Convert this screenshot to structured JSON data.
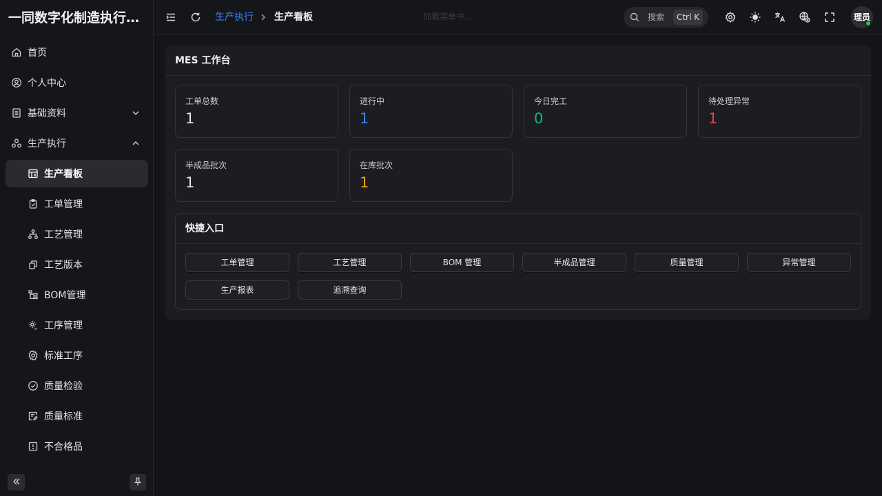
{
  "app": {
    "title": "一同数字化制造执行管..."
  },
  "colors": {
    "accent": "#3b82f6",
    "success": "#10b981",
    "danger": "#ef4444",
    "warning": "#f59e0b",
    "online": "#22c55e"
  },
  "sidebar": {
    "items": [
      {
        "label": "首页",
        "icon": "home-icon"
      },
      {
        "label": "个人中心",
        "icon": "user-circle-icon"
      },
      {
        "label": "基础资料",
        "icon": "document-list-icon",
        "expanded": false
      },
      {
        "label": "生产执行",
        "icon": "flow-nodes-icon",
        "expanded": true
      }
    ],
    "subitems": [
      {
        "label": "生产看板",
        "icon": "calendar-board-icon",
        "active": true
      },
      {
        "label": "工单管理",
        "icon": "clipboard-check-icon"
      },
      {
        "label": "工艺管理",
        "icon": "hierarchy-icon"
      },
      {
        "label": "工艺版本",
        "icon": "copy-icon"
      },
      {
        "label": "BOM管理",
        "icon": "tree-list-icon"
      },
      {
        "label": "工序管理",
        "icon": "gear-settings-icon"
      },
      {
        "label": "标准工序",
        "icon": "cog-icon"
      },
      {
        "label": "质量检验",
        "icon": "check-circle-icon"
      },
      {
        "label": "质量标准",
        "icon": "document-edit-icon"
      },
      {
        "label": "不合格品",
        "icon": "alert-square-icon"
      }
    ]
  },
  "header": {
    "breadcrumb": [
      "生产执行",
      "生产看板"
    ],
    "loading_text": "加载菜单中...",
    "search": {
      "placeholder": "搜索",
      "shortcut": "Ctrl K"
    },
    "avatar_text": "理员"
  },
  "main": {
    "card_title": "MES 工作台",
    "stats": [
      {
        "label": "工单总数",
        "value": "1",
        "color": "#e6e6e6"
      },
      {
        "label": "进行中",
        "value": "1",
        "color": "#3b82f6"
      },
      {
        "label": "今日完工",
        "value": "0",
        "color": "#10b981"
      },
      {
        "label": "待处理异常",
        "value": "1",
        "color": "#ef4444"
      },
      {
        "label": "半成品批次",
        "value": "1",
        "color": "#e6e6e6"
      },
      {
        "label": "在库批次",
        "value": "1",
        "color": "#f59e0b"
      }
    ],
    "quick": {
      "title": "快捷入口",
      "buttons": [
        "工单管理",
        "工艺管理",
        "BOM 管理",
        "半成品管理",
        "质量管理",
        "异常管理",
        "生产报表",
        "追溯查询"
      ]
    }
  }
}
